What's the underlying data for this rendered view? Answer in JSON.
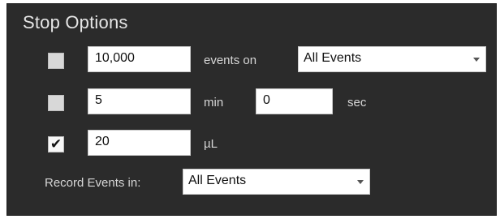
{
  "title": "Stop Options",
  "rows": {
    "events": {
      "checked": false,
      "value": "10,000",
      "label": "events on",
      "select_value": "All Events"
    },
    "time": {
      "checked": false,
      "min_value": "5",
      "min_label": "min",
      "sec_value": "0",
      "sec_label": "sec"
    },
    "volume": {
      "checked": true,
      "value": "20",
      "label": "µL"
    }
  },
  "record": {
    "label": "Record Events in:",
    "select_value": "All Events"
  },
  "icons": {
    "checkmark": "check-icon",
    "dropdown": "chevron-down-icon"
  },
  "colors": {
    "panel_background": "#2b2b2b",
    "text_light": "#d6d6d6"
  }
}
